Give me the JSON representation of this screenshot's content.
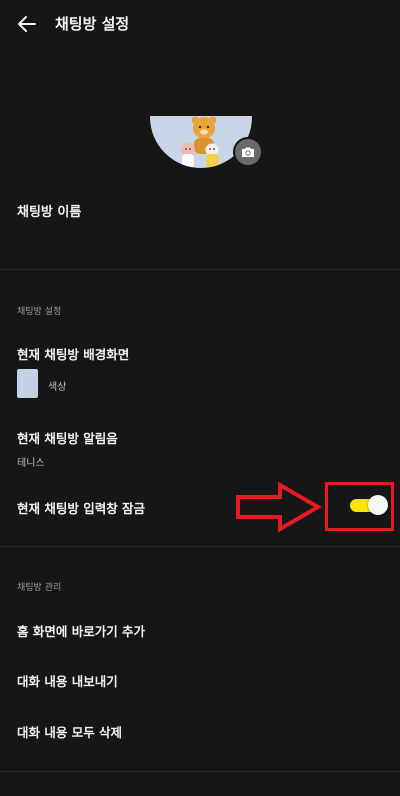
{
  "header": {
    "title": "채팅방 설정"
  },
  "profile": {
    "name_label": "채팅방 이름"
  },
  "sections": {
    "settings": {
      "title": "채팅방 설정",
      "background": {
        "label": "현재 채팅방 배경화면",
        "value": "색상",
        "swatch_color": "#c3d1e4"
      },
      "notification": {
        "label": "현재 채팅방 알림음",
        "value": "테니스"
      },
      "input_lock": {
        "label": "현재 채팅방 입력창 잠금",
        "enabled": true
      }
    },
    "management": {
      "title": "채팅방 관리",
      "items": [
        "홈 화면에 바로가기 추가",
        "대화 내용 내보내기",
        "대화 내용 모두 삭제"
      ]
    }
  },
  "colors": {
    "background": "#161616",
    "toggle_on": "#f7e600",
    "annotation": "#e31b23"
  },
  "icons": {
    "back": "arrow-left-icon",
    "camera": "camera-icon"
  }
}
